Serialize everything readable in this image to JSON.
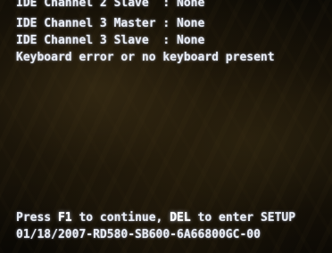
{
  "post_screen": {
    "ide_lines": [
      "IDE Channel 2 Slave  : None",
      "IDE Channel 3 Master : None",
      "IDE Channel 3 Slave  : None"
    ],
    "error_message": "Keyboard error or no keyboard present",
    "prompt": {
      "press": "Press ",
      "f1_key": "F1",
      "to_continue": " to continue, ",
      "del_key": "DEL",
      "to_setup": " to enter SETUP"
    },
    "bios_id": "01/18/2007-RD580-SB600-6A66800GC-00"
  },
  "colors": {
    "text": "#e8ecf4",
    "highlight": "#ffffff",
    "background": "#120e06"
  }
}
